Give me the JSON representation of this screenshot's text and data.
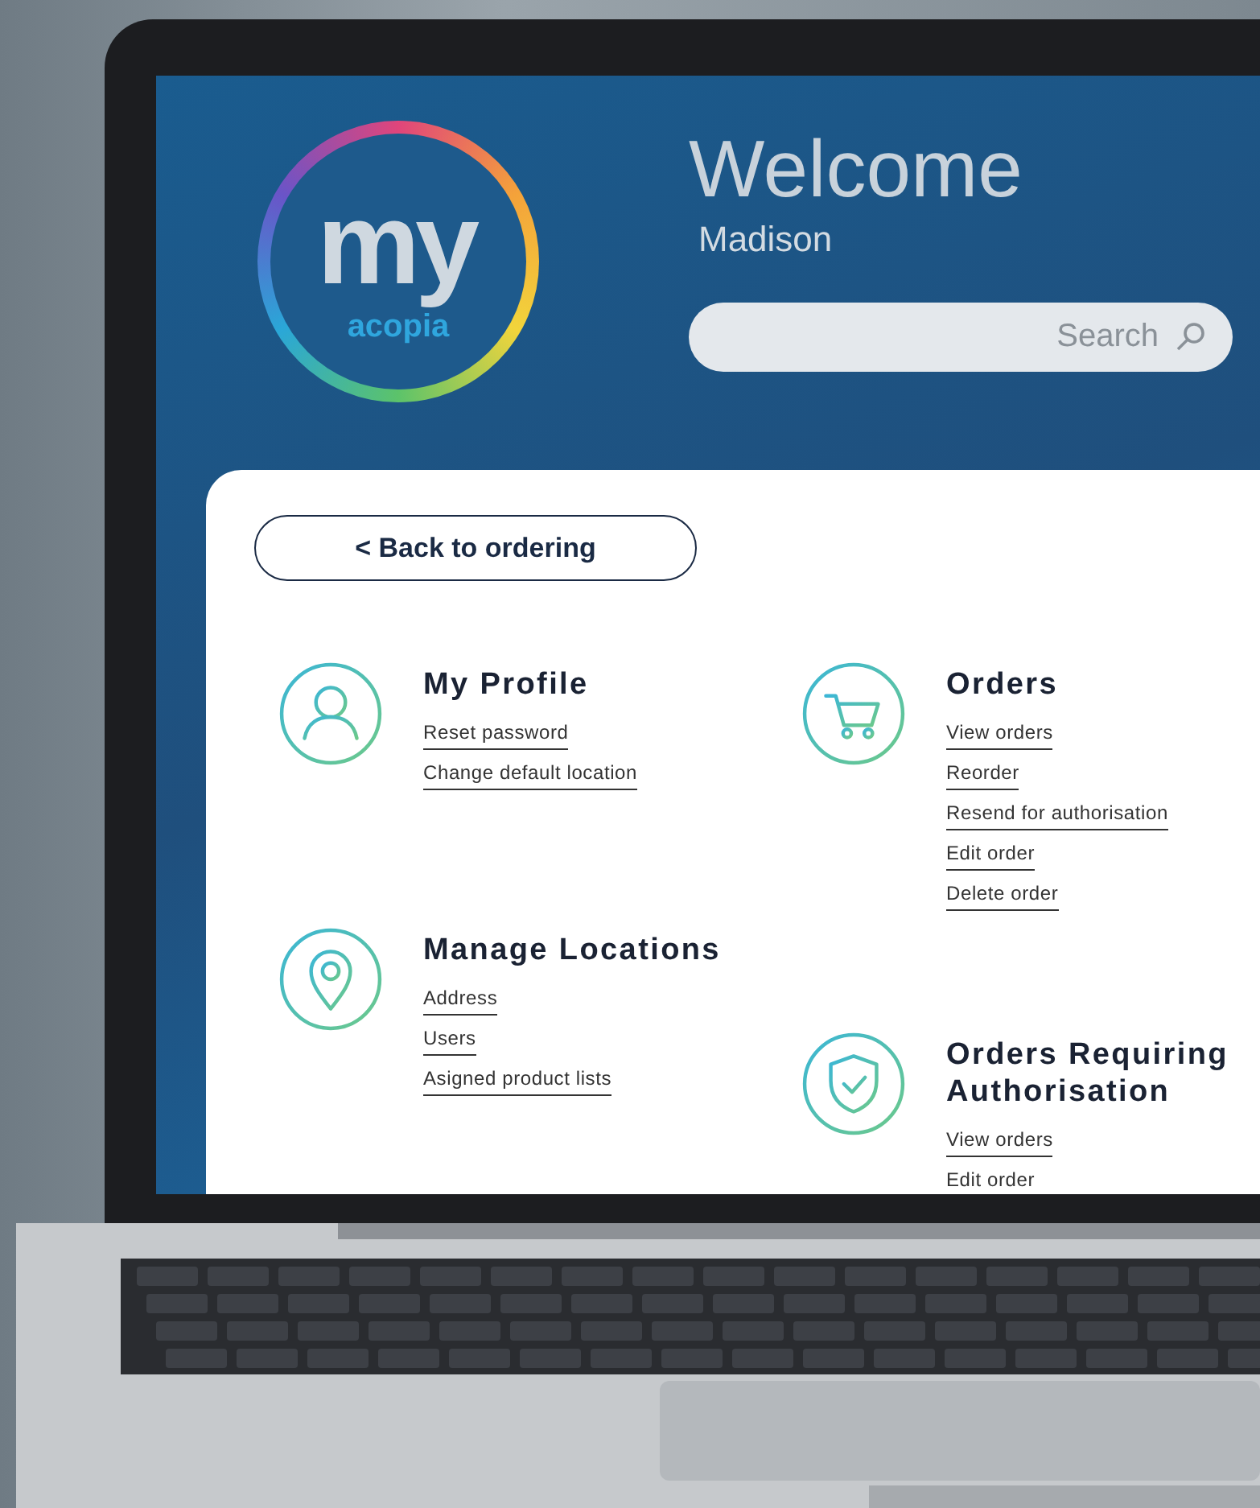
{
  "header": {
    "logo": {
      "primary": "my",
      "secondary": "acopia"
    },
    "title": "Welcome",
    "user_name": "Madison",
    "search": {
      "placeholder": "Search"
    }
  },
  "back_button": "< Back to ordering",
  "columns": [
    {
      "sections": [
        {
          "title": "My Profile",
          "kind": "user",
          "links": [
            "Reset password",
            "Change default location"
          ]
        },
        {
          "title": "Manage Locations",
          "kind": "pin",
          "links": [
            "Address",
            "Users",
            "Asigned product lists"
          ]
        }
      ]
    },
    {
      "sections": [
        {
          "title": "Orders",
          "kind": "cart",
          "links": [
            "View orders",
            "Reorder",
            "Resend for authorisation",
            "Edit order",
            "Delete order"
          ]
        },
        {
          "title": "Orders Requiring Authorisation",
          "kind": "shield",
          "links": [
            "View orders",
            "Edit order"
          ]
        }
      ]
    }
  ]
}
